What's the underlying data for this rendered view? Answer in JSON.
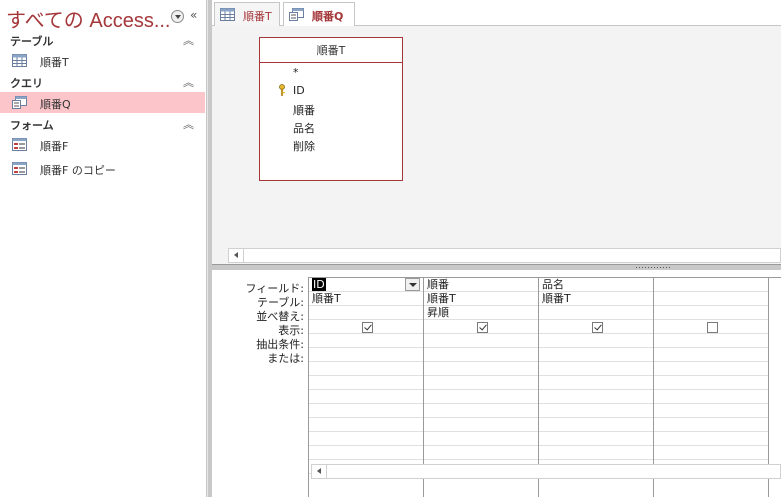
{
  "nav": {
    "title": "すべての Access...",
    "groups": [
      {
        "label": "テーブル",
        "items": [
          {
            "label": "順番T",
            "icon": "table-icon"
          }
        ]
      },
      {
        "label": "クエリ",
        "items": [
          {
            "label": "順番Q",
            "icon": "query-icon",
            "selected": true
          }
        ]
      },
      {
        "label": "フォーム",
        "items": [
          {
            "label": "順番F",
            "icon": "form-icon"
          },
          {
            "label": "順番F のコピー",
            "icon": "form-icon"
          }
        ]
      }
    ]
  },
  "tabs": [
    {
      "label": "順番T",
      "icon": "table-icon"
    },
    {
      "label": "順番Q",
      "icon": "query-icon",
      "active": true
    }
  ],
  "table_box": {
    "title": "順番T",
    "fields": [
      "*",
      "ID",
      "順番",
      "品名",
      "削除"
    ]
  },
  "grid": {
    "row_labels": [
      "フィールド:",
      "テーブル:",
      "並べ替え:",
      "表示:",
      "抽出条件:",
      "または:"
    ],
    "columns": [
      {
        "field": "ID",
        "table": "順番T",
        "sort": "",
        "show": true
      },
      {
        "field": "順番",
        "table": "順番T",
        "sort": "昇順",
        "show": true
      },
      {
        "field": "品名",
        "table": "順番T",
        "sort": "",
        "show": true
      },
      {
        "field": "",
        "table": "",
        "sort": "",
        "show": false
      }
    ]
  },
  "colors": {
    "accent": "#a4373a",
    "selected_bg": "#fbc5c9"
  }
}
